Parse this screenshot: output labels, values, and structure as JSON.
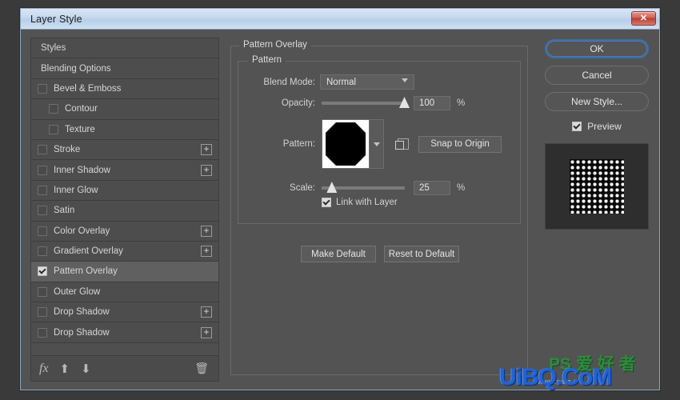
{
  "window": {
    "title": "Layer Style",
    "close_label": "✕"
  },
  "sidebar": {
    "items": [
      {
        "label": "Styles",
        "type": "header",
        "checkbox": null,
        "plus": false,
        "selected": false,
        "indent": false
      },
      {
        "label": "Blending Options",
        "type": "header",
        "checkbox": null,
        "plus": false,
        "selected": false,
        "indent": false
      },
      {
        "label": "Bevel & Emboss",
        "type": "effect",
        "checkbox": false,
        "plus": false,
        "selected": false,
        "indent": false
      },
      {
        "label": "Contour",
        "type": "sub",
        "checkbox": false,
        "plus": false,
        "selected": false,
        "indent": true
      },
      {
        "label": "Texture",
        "type": "sub",
        "checkbox": false,
        "plus": false,
        "selected": false,
        "indent": true
      },
      {
        "label": "Stroke",
        "type": "effect",
        "checkbox": false,
        "plus": true,
        "selected": false,
        "indent": false
      },
      {
        "label": "Inner Shadow",
        "type": "effect",
        "checkbox": false,
        "plus": true,
        "selected": false,
        "indent": false
      },
      {
        "label": "Inner Glow",
        "type": "effect",
        "checkbox": false,
        "plus": false,
        "selected": false,
        "indent": false
      },
      {
        "label": "Satin",
        "type": "effect",
        "checkbox": false,
        "plus": false,
        "selected": false,
        "indent": false
      },
      {
        "label": "Color Overlay",
        "type": "effect",
        "checkbox": false,
        "plus": true,
        "selected": false,
        "indent": false
      },
      {
        "label": "Gradient Overlay",
        "type": "effect",
        "checkbox": false,
        "plus": true,
        "selected": false,
        "indent": false
      },
      {
        "label": "Pattern Overlay",
        "type": "effect",
        "checkbox": true,
        "plus": false,
        "selected": true,
        "indent": false
      },
      {
        "label": "Outer Glow",
        "type": "effect",
        "checkbox": false,
        "plus": false,
        "selected": false,
        "indent": false
      },
      {
        "label": "Drop Shadow",
        "type": "effect",
        "checkbox": false,
        "plus": true,
        "selected": false,
        "indent": false
      },
      {
        "label": "Drop Shadow",
        "type": "effect",
        "checkbox": false,
        "plus": true,
        "selected": false,
        "indent": false
      }
    ],
    "toolbar": {
      "fx_label": "fx",
      "move_up_label": "⬆",
      "move_down_label": "⬇",
      "delete_label": "🗑"
    }
  },
  "main": {
    "group_title": "Pattern Overlay",
    "subgroup_title": "Pattern",
    "blend_mode": {
      "label": "Blend Mode:",
      "value": "Normal"
    },
    "opacity": {
      "label": "Opacity:",
      "value": "100",
      "unit": "%",
      "percent": 100
    },
    "pattern": {
      "label": "Pattern:",
      "swatch_name": "octagon-pattern",
      "new_preset_icon": "new-preset-icon",
      "snap_button": "Snap to Origin"
    },
    "scale": {
      "label": "Scale:",
      "value": "25",
      "unit": "%",
      "percent": 8
    },
    "link_with_layer": {
      "label": "Link with Layer",
      "checked": true
    },
    "buttons": {
      "make_default": "Make Default",
      "reset_to_default": "Reset to Default"
    }
  },
  "right": {
    "ok": "OK",
    "cancel": "Cancel",
    "new_style": "New Style...",
    "preview": {
      "label": "Preview",
      "checked": true
    }
  },
  "watermark": {
    "main": "UiBQ.CoM",
    "sub": "PS 爱 好 者",
    "tiny": "www.sa.z"
  },
  "colors": {
    "dialog_bg": "#535353",
    "titlebar": "#c4d8ed",
    "accent_blue": "#3f6ea8",
    "text": "#e0e0e0",
    "close_red": "#bb3f33"
  }
}
